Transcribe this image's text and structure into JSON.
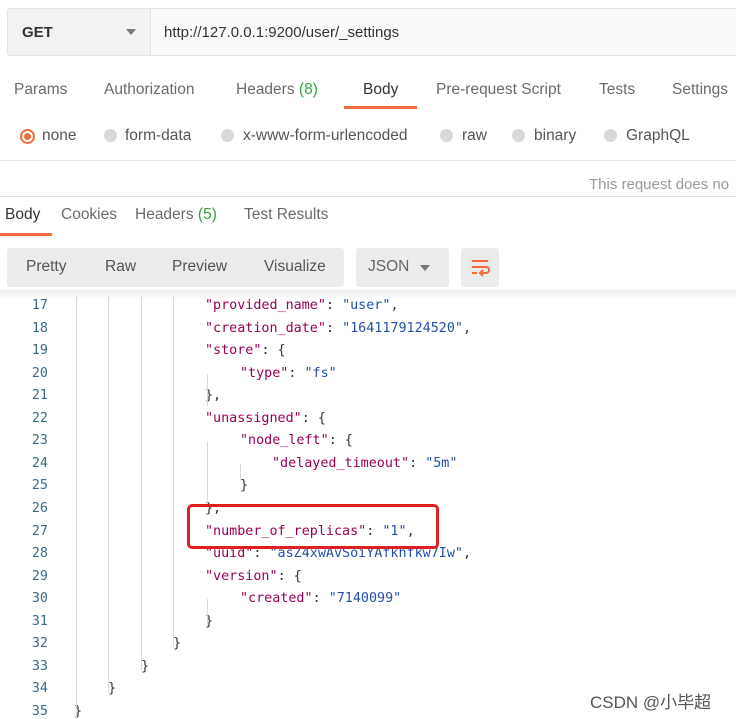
{
  "request": {
    "method": "GET",
    "url": "http://127.0.0.1:9200/user/_settings"
  },
  "request_tabs": {
    "params": "Params",
    "authorization": "Authorization",
    "headers": "Headers",
    "headers_count": "(8)",
    "body": "Body",
    "prerequest": "Pre-request Script",
    "tests": "Tests",
    "settings": "Settings"
  },
  "body_types": {
    "none": "none",
    "form_data": "form-data",
    "urlencoded": "x-www-form-urlencoded",
    "raw": "raw",
    "binary": "binary",
    "graphql": "GraphQL",
    "selected": "none"
  },
  "note": "This request does no",
  "response_tabs": {
    "body": "Body",
    "cookies": "Cookies",
    "headers": "Headers",
    "headers_count": "(5)",
    "test_results": "Test Results"
  },
  "view": {
    "pretty": "Pretty",
    "raw": "Raw",
    "preview": "Preview",
    "visualize": "Visualize",
    "format": "JSON"
  },
  "code_lines": [
    {
      "n": "17",
      "key": "\"provided_name\"",
      "rest": ": ",
      "val": "\"user\"",
      "end": ","
    },
    {
      "n": "18",
      "key": "\"creation_date\"",
      "rest": ": ",
      "val": "\"1641179124520\"",
      "end": ","
    },
    {
      "n": "19",
      "key": "\"store\"",
      "rest": ": {",
      "val": "",
      "end": ""
    },
    {
      "n": "20",
      "key": "\"type\"",
      "rest": ": ",
      "val": "\"fs\"",
      "end": ""
    },
    {
      "n": "21",
      "key": "",
      "rest": "},",
      "val": "",
      "end": ""
    },
    {
      "n": "22",
      "key": "\"unassigned\"",
      "rest": ": {",
      "val": "",
      "end": ""
    },
    {
      "n": "23",
      "key": "\"node_left\"",
      "rest": ": {",
      "val": "",
      "end": ""
    },
    {
      "n": "24",
      "key": "\"delayed_timeout\"",
      "rest": ": ",
      "val": "\"5m\"",
      "end": ""
    },
    {
      "n": "25",
      "key": "",
      "rest": "}",
      "val": "",
      "end": ""
    },
    {
      "n": "26",
      "key": "",
      "rest": "},",
      "val": "",
      "end": ""
    },
    {
      "n": "27",
      "key": "\"number_of_replicas\"",
      "rest": ": ",
      "val": "\"1\"",
      "end": ","
    },
    {
      "n": "28",
      "key": "\"uuid\"",
      "rest": ": ",
      "val": "\"asZ4xwAvSoiYAfkhfkw7Iw\"",
      "end": ","
    },
    {
      "n": "29",
      "key": "\"version\"",
      "rest": ": {",
      "val": "",
      "end": ""
    },
    {
      "n": "30",
      "key": "\"created\"",
      "rest": ": ",
      "val": "\"7140099\"",
      "end": ""
    },
    {
      "n": "31",
      "key": "",
      "rest": "}",
      "val": "",
      "end": ""
    },
    {
      "n": "32",
      "key": "",
      "rest": "}",
      "val": "",
      "end": ""
    },
    {
      "n": "33",
      "key": "",
      "rest": "}",
      "val": "",
      "end": ""
    },
    {
      "n": "34",
      "key": "",
      "rest": "}",
      "val": "",
      "end": ""
    },
    {
      "n": "35",
      "key": "",
      "rest": "}",
      "val": "",
      "end": ""
    }
  ],
  "watermark": "CSDN @小毕超",
  "colors": {
    "accent": "#f26b3a",
    "count_green": "#2ea836",
    "highlight_red": "#e02020",
    "json_key": "#990055",
    "json_string": "#2450a8"
  }
}
